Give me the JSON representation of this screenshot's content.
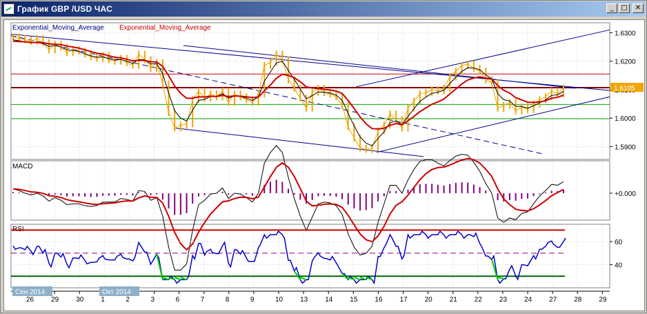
{
  "window": {
    "title": "График GBP /USD  ЧАС",
    "buttons": {
      "minimize": "_",
      "restore": "□",
      "close": "✕"
    }
  },
  "colors": {
    "price": "#f0a500",
    "ema_fast": "#000000",
    "ema_slow": "#cc0000",
    "channel": "#00008b",
    "level_red": "#cc0000",
    "level_dark": "#800000",
    "level_green": "#00aa00",
    "macd_hist": "#800080",
    "rsi_line": "#0000cc",
    "rsi_low": "#00cc00",
    "price_tag_bg": "#f0a500"
  },
  "chart_data": [
    {
      "type": "line",
      "panel": "price",
      "legend": [
        "Exponential_Moving_Average",
        "Exponential_Moving_Average"
      ],
      "y_ticks": [
        "1.6300",
        "1.6200",
        "1.6100",
        "1.6000",
        "1.5900"
      ],
      "ylim": [
        1.5855,
        1.6335
      ],
      "current_price_label": "1.6105",
      "horizontal_levels": [
        1.6155,
        1.6107,
        1.6048,
        1.5998
      ],
      "price_series": [
        1.6285,
        1.628,
        1.6275,
        1.627,
        1.628,
        1.6265,
        1.624,
        1.626,
        1.625,
        1.623,
        1.624,
        1.6235,
        1.6225,
        1.6215,
        1.621,
        1.622,
        1.6205,
        1.62,
        1.621,
        1.6195,
        1.6185,
        1.6225,
        1.6205,
        1.6175,
        1.6195,
        1.612,
        1.602,
        1.5965,
        1.5975,
        1.598,
        1.6065,
        1.6095,
        1.607,
        1.6085,
        1.6075,
        1.6095,
        1.6055,
        1.6085,
        1.6075,
        1.6065,
        1.6055,
        1.6085,
        1.6185,
        1.6195,
        1.6225,
        1.6205,
        1.6135,
        1.6105,
        1.607,
        1.6035,
        1.609,
        1.6105,
        1.609,
        1.6085,
        1.6075,
        1.6045,
        1.597,
        1.593,
        1.5895,
        1.589,
        1.5895,
        1.5955,
        1.5975,
        1.6015,
        1.5995,
        1.5965,
        1.6035,
        1.606,
        1.6085,
        1.609,
        1.61,
        1.6095,
        1.6105,
        1.6145,
        1.6165,
        1.6185,
        1.619,
        1.6175,
        1.6165,
        1.6135,
        1.6125,
        1.6035,
        1.6045,
        1.6055,
        1.6025,
        1.604,
        1.603,
        1.605,
        1.6065,
        1.6075,
        1.6095,
        1.6085,
        1.6105
      ],
      "ema_fast": [
        1.6275,
        1.6272,
        1.6268,
        1.6264,
        1.6266,
        1.6262,
        1.6252,
        1.6255,
        1.625,
        1.624,
        1.6238,
        1.6234,
        1.6226,
        1.6219,
        1.6214,
        1.6215,
        1.6209,
        1.6204,
        1.6206,
        1.62,
        1.6192,
        1.6206,
        1.6205,
        1.619,
        1.6192,
        1.6156,
        1.6088,
        1.6026,
        1.6,
        1.599,
        1.6028,
        1.6062,
        1.6066,
        1.6076,
        1.6076,
        1.6086,
        1.607,
        1.6078,
        1.6076,
        1.607,
        1.6062,
        1.6074,
        1.613,
        1.6162,
        1.6194,
        1.62,
        1.6168,
        1.6136,
        1.6102,
        1.6068,
        1.6079,
        1.6092,
        1.6091,
        1.6088,
        1.6081,
        1.6063,
        1.6016,
        1.5973,
        1.5934,
        1.5912,
        1.5903,
        1.5929,
        1.5952,
        1.5984,
        1.599,
        1.5977,
        1.6006,
        1.6033,
        1.6059,
        1.6074,
        1.6087,
        1.6091,
        1.6098,
        1.6122,
        1.6144,
        1.6164,
        1.6177,
        1.6176,
        1.617,
        1.6152,
        1.6138,
        1.6086,
        1.6065,
        1.606,
        1.6042,
        1.6041,
        1.6035,
        1.6043,
        1.6054,
        1.6064,
        1.608,
        1.6082,
        1.6094
      ],
      "ema_slow": [
        1.627,
        1.6269,
        1.6268,
        1.6266,
        1.6266,
        1.6265,
        1.6261,
        1.626,
        1.6258,
        1.6253,
        1.625,
        1.6246,
        1.624,
        1.6234,
        1.6228,
        1.6225,
        1.6219,
        1.6214,
        1.6212,
        1.6207,
        1.6201,
        1.6203,
        1.6203,
        1.6198,
        1.6197,
        1.6182,
        1.6149,
        1.6113,
        1.6087,
        1.607,
        1.607,
        1.6075,
        1.6074,
        1.6077,
        1.6076,
        1.608,
        1.6076,
        1.6078,
        1.6077,
        1.6075,
        1.6072,
        1.6074,
        1.6096,
        1.6116,
        1.614,
        1.6154,
        1.615,
        1.6142,
        1.6128,
        1.611,
        1.6106,
        1.6104,
        1.6101,
        1.6099,
        1.6095,
        1.6087,
        1.6062,
        1.6034,
        1.6004,
        1.598,
        1.5963,
        1.5962,
        1.5964,
        1.5975,
        1.5981,
        1.5977,
        1.5991,
        1.6006,
        1.6023,
        1.6036,
        1.6049,
        1.6057,
        1.6067,
        1.6085,
        1.6102,
        1.612,
        1.6134,
        1.6141,
        1.6145,
        1.6141,
        1.6138,
        1.6114,
        1.6098,
        1.6088,
        1.6072,
        1.6064,
        1.6056,
        1.6055,
        1.6057,
        1.6061,
        1.607,
        1.6073,
        1.6081
      ]
    },
    {
      "type": "line",
      "panel": "macd",
      "title": "MACD",
      "y_ticks": [
        "+0.000"
      ],
      "ylim": [
        -1,
        1
      ]
    },
    {
      "type": "line",
      "panel": "rsi",
      "title": "RSI",
      "y_ticks": [
        "60",
        "40"
      ],
      "ylim": [
        20,
        75
      ],
      "levels": {
        "upper": 70,
        "middle": 50,
        "lower": 30
      }
    }
  ],
  "x_axis": {
    "ticks": [
      "26",
      "29",
      "30",
      "1",
      "2",
      "3",
      "6",
      "7",
      "8",
      "9",
      "10",
      "13",
      "14",
      "15",
      "16",
      "17",
      "20",
      "21",
      "22",
      "23",
      "24",
      "27",
      "28",
      "29"
    ],
    "month_labels": [
      "Сен 2014",
      "Окт 2014"
    ]
  }
}
